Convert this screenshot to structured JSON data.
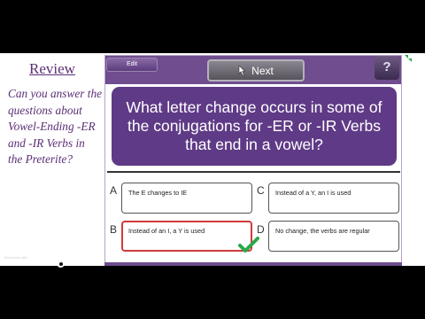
{
  "review": {
    "title": "Review",
    "text": "Can you answer the questions about Vowel-Ending -ER and -IR Verbs in the Preterite?"
  },
  "toolbar": {
    "edit_label": "Edit",
    "next_label": "Next",
    "help_label": "?"
  },
  "question": {
    "text": "What letter change occurs in some of the conjugations for  -ER or -IR Verbs that end in a vowel?"
  },
  "answers": [
    {
      "letter": "A",
      "text": "The E changes to IE",
      "selected": false
    },
    {
      "letter": "B",
      "text": "Instead of an I, a Y is used",
      "selected": true
    },
    {
      "letter": "C",
      "text": "Instead of a Y, an I is used",
      "selected": false
    },
    {
      "letter": "D",
      "text": "No change, the verbs are regular",
      "selected": false
    }
  ],
  "watermark": {
    "small": "Recorded with",
    "main_left": "SCREENCAST",
    "main_right": "MATIC"
  },
  "colors": {
    "accent_purple": "#5f3a86",
    "review_text": "#5b2e76",
    "selected_border": "#d23a3a",
    "check_green": "#2aa84a"
  },
  "icons": [
    "cursor-icon",
    "help-icon",
    "check-icon",
    "corner-icon"
  ]
}
